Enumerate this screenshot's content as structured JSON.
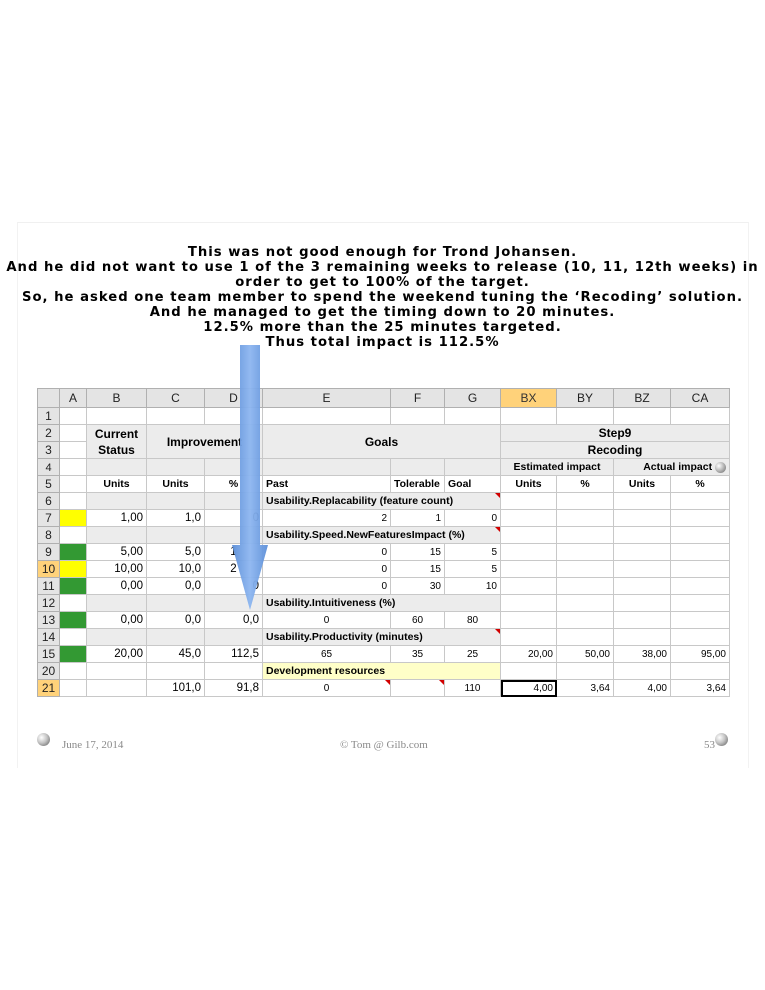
{
  "title_lines": [
    "This was not good enough for Trond Johansen.",
    "And he did not want to use 1 of the 3 remaining weeks to release (10, 11, 12th weeks) in",
    "order to get to 100% of the target.",
    "So, he asked one team member to spend the weekend tuning the ‘Recoding’ solution.",
    "And he managed to get the timing down to 20 minutes.",
    "12.5% more than the 25 minutes targeted.",
    "Thus total impact is 112.5%"
  ],
  "sheet": {
    "col_headers": [
      "A",
      "B",
      "C",
      "D",
      "E",
      "F",
      "G",
      "BX",
      "BY",
      "BZ",
      "CA"
    ],
    "row_numbers": [
      "1",
      "2",
      "3",
      "4",
      "5",
      "6",
      "7",
      "8",
      "9",
      "10",
      "11",
      "12",
      "13",
      "14",
      "15",
      "20",
      "21"
    ],
    "current_status": "Current Status",
    "improvement": "Improvement",
    "goals": "Goals",
    "step": "Step9",
    "recoding": "Recoding",
    "estimated_impact": "Estimated impact",
    "actual_impact": "Actual impact",
    "row5": [
      "Units",
      "Units",
      "%",
      "Past",
      "Tolerable",
      "Goal",
      "Units",
      "%",
      "Units",
      "%"
    ],
    "row6_label": "Usability.Replacability (feature count)",
    "row7": [
      "1,00",
      "1,0",
      "",
      "2",
      "1",
      "0"
    ],
    "row8_label": "Usability.Speed.NewFeaturesImpact (%)",
    "row9": [
      "5,00",
      "5,0",
      "",
      "0",
      "15",
      "5"
    ],
    "row10": [
      "10,00",
      "10,0",
      "",
      "0",
      "15",
      "5"
    ],
    "row11": [
      "0,00",
      "0,0",
      "",
      "0",
      "30",
      "10"
    ],
    "row12_label": "Usability.Intuitiveness (%)",
    "row13": [
      "0,00",
      "0,0",
      "0,0",
      "0",
      "60",
      "80"
    ],
    "row14_label": "Usability.Productivity (minutes)",
    "row15": [
      "20,00",
      "45,0",
      "112,5",
      "65",
      "35",
      "25",
      "20,00",
      "50,00",
      "38,00",
      "95,00"
    ],
    "row20_label": "Development resources",
    "row21": [
      "101,0",
      "91,8",
      "0",
      "110",
      "4,00",
      "3,64",
      "4,00",
      "3,64"
    ],
    "d_partial_7": "0",
    "d_partial_9": "1",
    "d_partial_10": "2",
    "d_partial_11": "0"
  },
  "footer": {
    "date": "June 17, 2014",
    "copyright": "© Tom @ Gilb.com",
    "page": "53"
  },
  "colors": {
    "arrow": "#6f9ee0",
    "status_green": "#339933",
    "status_yellow": "#ffff00",
    "selected_header": "#ffd27a"
  }
}
